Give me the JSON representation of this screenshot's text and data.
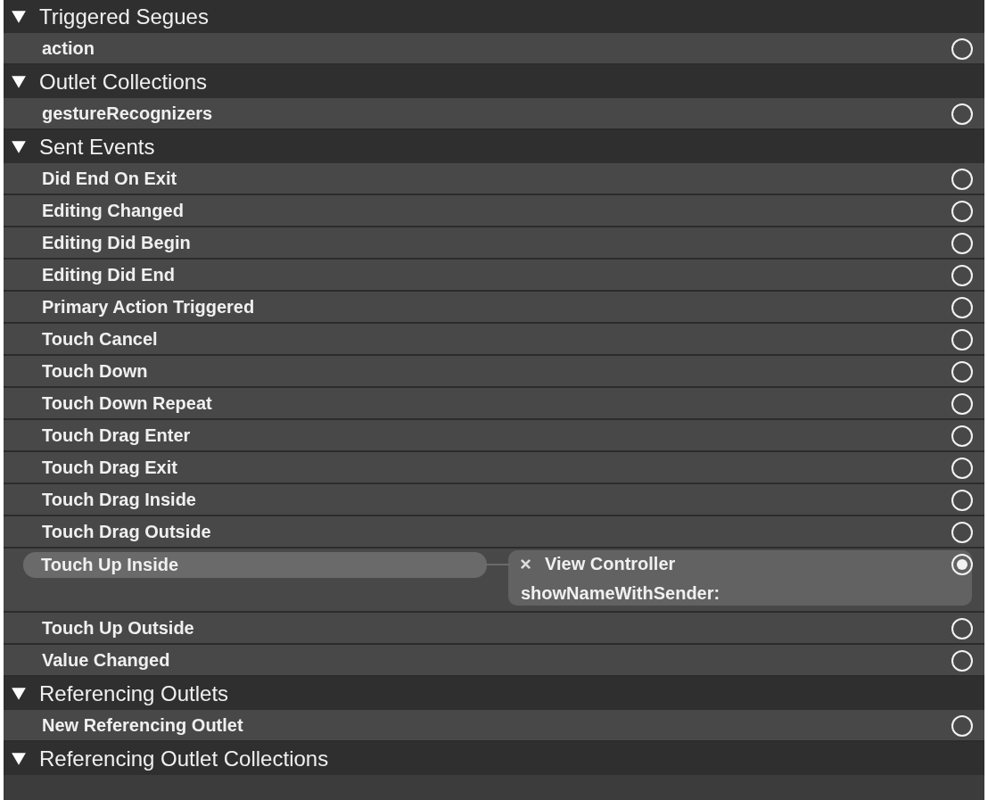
{
  "sections": [
    {
      "title": "Triggered Segues",
      "expanded": true,
      "items": [
        {
          "label": "action",
          "connected": false
        }
      ]
    },
    {
      "title": "Outlet Collections",
      "expanded": true,
      "items": [
        {
          "label": "gestureRecognizers",
          "connected": false
        }
      ]
    },
    {
      "title": "Sent Events",
      "expanded": true,
      "items": [
        {
          "label": "Did End On Exit",
          "connected": false
        },
        {
          "label": "Editing Changed",
          "connected": false
        },
        {
          "label": "Editing Did Begin",
          "connected": false
        },
        {
          "label": "Editing Did End",
          "connected": false
        },
        {
          "label": "Primary Action Triggered",
          "connected": false
        },
        {
          "label": "Touch Cancel",
          "connected": false
        },
        {
          "label": "Touch Down",
          "connected": false
        },
        {
          "label": "Touch Down Repeat",
          "connected": false
        },
        {
          "label": "Touch Drag Enter",
          "connected": false
        },
        {
          "label": "Touch Drag Exit",
          "connected": false
        },
        {
          "label": "Touch Drag Inside",
          "connected": false
        },
        {
          "label": "Touch Drag Outside",
          "connected": false
        },
        {
          "label": "Touch Up Inside",
          "connected": true,
          "connection": {
            "target": "View Controller",
            "action": "showNameWithSender:"
          }
        },
        {
          "label": "Touch Up Outside",
          "connected": false
        },
        {
          "label": "Value Changed",
          "connected": false
        }
      ]
    },
    {
      "title": "Referencing Outlets",
      "expanded": true,
      "items": [
        {
          "label": "New Referencing Outlet",
          "connected": false
        }
      ]
    },
    {
      "title": "Referencing Outlet Collections",
      "expanded": true
    }
  ]
}
